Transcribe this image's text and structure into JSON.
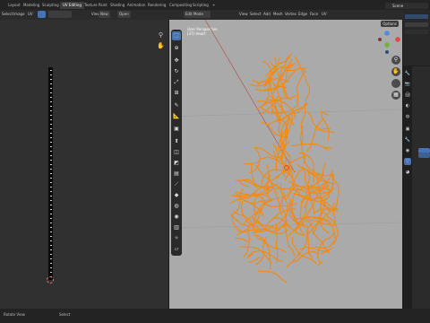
{
  "workspace_tabs": [
    "Layout",
    "Modeling",
    "Sculpting",
    "UV Editing",
    "Texture Paint",
    "Shading",
    "Animation",
    "Rendering",
    "Compositing",
    "Scripting"
  ],
  "active_tab_index": 3,
  "scene_name": "Scene",
  "uv_header": {
    "select_label": "Select",
    "image_label": "Image",
    "uv_label": "UV",
    "view_label": "View",
    "new_label": "New",
    "open_label": "Open"
  },
  "viewport_header": {
    "mode_label": "Edit Mode",
    "menus": [
      "View",
      "Select",
      "Add",
      "Mesh",
      "Vertex",
      "Edge",
      "Face",
      "UV"
    ],
    "options_label": "Options"
  },
  "viewport_info": {
    "line1": "User Perspective",
    "line2": "(37) Heart"
  },
  "statusbar": {
    "left": "Rotate View",
    "right": "Select"
  },
  "colors": {
    "wire": "#f5890f",
    "accent": "#4772b3",
    "axis_red": "#e04949",
    "axis_green": "#6fb33a",
    "axis_blue": "#4f8ae0"
  }
}
